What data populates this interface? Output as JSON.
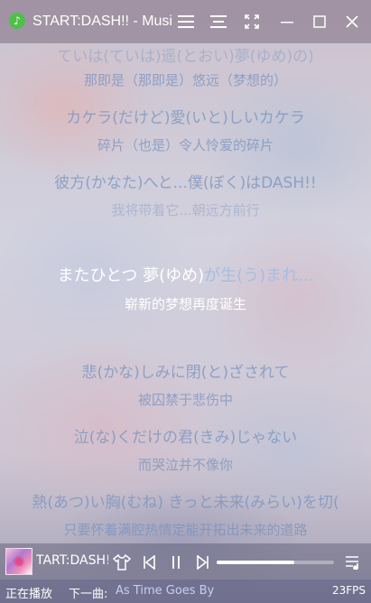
{
  "window": {
    "title": "START:DASH!! - Musi",
    "icon": "music-note-icon",
    "buttons": [
      "menu-icon",
      "list-icon",
      "fullscreen-icon",
      "minimize-icon",
      "maximize-icon",
      "close-icon"
    ]
  },
  "lyrics": [
    {
      "text": "ていは(ていは)遥(とおい)夢(ゆめ)の)",
      "kind": "jp",
      "faded": true
    },
    {
      "text": "那即是（那即是）悠远（梦想的）",
      "kind": "cn",
      "faded": false
    },
    {
      "text": "カケラ(だけど)愛(いと)しいカケラ",
      "kind": "jp",
      "faded": false
    },
    {
      "text": "碎片（也是）令人怜爱的碎片",
      "kind": "cn",
      "faded": false
    },
    {
      "text": "彼方(かなた)へと...僕(ぼく)はDASH!!",
      "kind": "jp",
      "faded": false
    },
    {
      "text": "我将带着它...朝远方前行",
      "kind": "cn",
      "faded": true
    },
    {
      "text": "悲(かな)しみに閉(と)ざされて",
      "kind": "jp",
      "faded": false
    },
    {
      "text": "被囚禁于悲伤中",
      "kind": "cn",
      "faded": false
    },
    {
      "text": "泣(な)くだけの君(きみ)じゃない",
      "kind": "jp",
      "faded": false
    },
    {
      "text": "而哭泣并不像你",
      "kind": "cn",
      "faded": false
    },
    {
      "text": "熱(あつ)い胸(むね) きっと未来(みらい)を切(",
      "kind": "jp",
      "faded": false
    },
    {
      "text": "只要怀着满腔热情定能开拓出未来的道路",
      "kind": "cn",
      "faded": false
    }
  ],
  "current_lyric": {
    "sung": "またひとつ 夢(ゆめ)",
    "unsung": "が生(う)まれ...",
    "translation": "崭新的梦想再度诞生"
  },
  "player": {
    "track_title": "TART:DASH!!",
    "cover_icon": "album-cover",
    "controls": [
      "shirt-icon",
      "previous-icon",
      "pause-icon",
      "next-icon",
      "playlist-icon"
    ],
    "progress": 0.66
  },
  "status": {
    "state": "正在播放",
    "next_label": "下一曲:",
    "next_song": "As Time Goes By",
    "fps": "23FPS"
  },
  "colors": {
    "accent": "#ffffff",
    "lyric_dim": "#7891be",
    "unsung": "#a8bde0"
  }
}
